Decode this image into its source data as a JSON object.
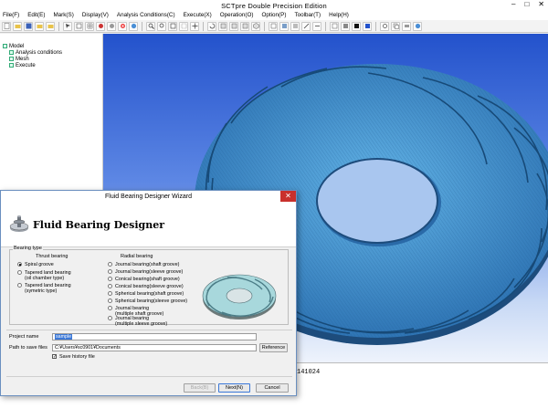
{
  "app": {
    "title": "SCTpre Double Precision Edition",
    "window_buttons": [
      "–",
      "□",
      "✕"
    ]
  },
  "menu": [
    "File(F)",
    "Edit(E)",
    "Mark(S)",
    "Display(V)",
    "Analysis Conditions(C)",
    "Execute(X)",
    "Operation(O)",
    "Option(P)",
    "Toolbar(T)",
    "Help(H)"
  ],
  "tree": {
    "items": [
      {
        "label": "Model",
        "indent": false
      },
      {
        "label": "Analysis conditions",
        "indent": true
      },
      {
        "label": "Mesh",
        "indent": true
      },
      {
        "label": "Execute",
        "indent": true
      }
    ]
  },
  "output": {
    "line": "141024"
  },
  "dialog": {
    "title": "Fluid Bearing Designer Wizard",
    "close": "✕",
    "heading": "Fluid Bearing Designer",
    "group_label": "Bearing type",
    "thrust": {
      "header": "Thrust bearing",
      "options": [
        {
          "label": "Spiral groove",
          "selected": true
        },
        {
          "label": "Tapered land bearing\n(oil chamber type)",
          "selected": false
        },
        {
          "label": "Tapered land bearing\n(symetric type)",
          "selected": false
        }
      ]
    },
    "radial": {
      "header": "Radial bearing",
      "options": [
        {
          "label": "Journal bearing(shaft groove)"
        },
        {
          "label": "Journal bearing(sleeve groove)"
        },
        {
          "label": "Conical bearing(shaft groove)"
        },
        {
          "label": "Conical bearing(sleeve groove)"
        },
        {
          "label": "Spherical bearing(shaft groove)"
        },
        {
          "label": "Spherical bearing(sleeve groove)"
        },
        {
          "label": "Journal bearing\n(multiple shaft groove)"
        },
        {
          "label": "Journal bearing\n(multiple sleeve groove)"
        }
      ]
    },
    "project_name": {
      "label": "Project name",
      "value": "sample"
    },
    "save_path": {
      "label": "Path to save files",
      "value": "C:¥Users¥sc0901¥Documents"
    },
    "reference_button": "Reference",
    "save_history": {
      "label": "Save history file",
      "checked": true
    },
    "back_button": "Back(B)",
    "next_button": "Next(N)",
    "cancel_button": "Cancel"
  },
  "colors": {
    "disk": "#3b86c8",
    "background_top": "#2352cc",
    "background_bottom": "#eef3fc",
    "selection": "#3b78d8",
    "close": "#c9302c"
  }
}
